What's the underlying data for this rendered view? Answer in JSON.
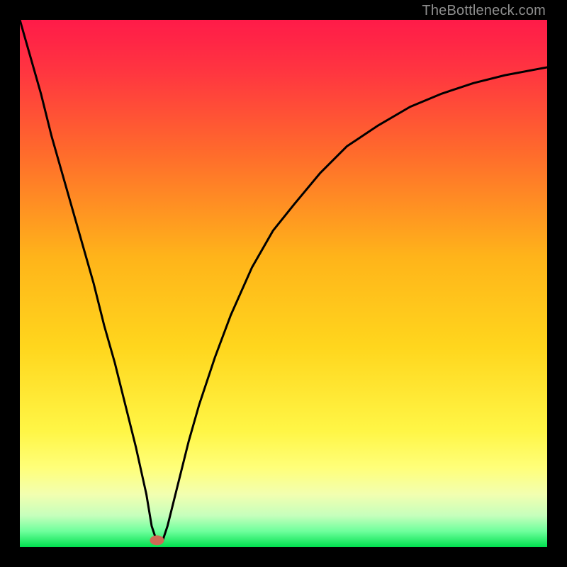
{
  "watermark": "TheBottleneck.com",
  "chart_data": {
    "type": "line",
    "title": "",
    "xlabel": "",
    "ylabel": "",
    "xlim": [
      0,
      100
    ],
    "ylim": [
      0,
      100
    ],
    "gradient_stops": [
      {
        "offset": 0.0,
        "color": "#ff1b49"
      },
      {
        "offset": 0.1,
        "color": "#ff3640"
      },
      {
        "offset": 0.25,
        "color": "#ff6a2c"
      },
      {
        "offset": 0.45,
        "color": "#ffb41a"
      },
      {
        "offset": 0.62,
        "color": "#ffd61d"
      },
      {
        "offset": 0.78,
        "color": "#fff646"
      },
      {
        "offset": 0.85,
        "color": "#ffff7a"
      },
      {
        "offset": 0.9,
        "color": "#f2ffb0"
      },
      {
        "offset": 0.94,
        "color": "#c6ffbc"
      },
      {
        "offset": 0.97,
        "color": "#6eff9c"
      },
      {
        "offset": 1.0,
        "color": "#00e04e"
      }
    ],
    "series": [
      {
        "name": "bottleneck-curve",
        "x": [
          0,
          2,
          4,
          6,
          8,
          10,
          12,
          14,
          16,
          18,
          20,
          22,
          24,
          25,
          26,
          27,
          28,
          30,
          32,
          34,
          37,
          40,
          44,
          48,
          52,
          57,
          62,
          68,
          74,
          80,
          86,
          92,
          100
        ],
        "y": [
          100,
          93,
          86,
          78,
          71,
          64,
          57,
          50,
          42,
          35,
          27,
          19,
          10,
          4,
          1,
          1,
          4,
          12,
          20,
          27,
          36,
          44,
          53,
          60,
          65,
          71,
          76,
          80,
          83.5,
          86,
          88,
          89.5,
          91
        ]
      }
    ],
    "marker": {
      "x": 26,
      "y": 1.3,
      "color": "#cf6a55",
      "rx": 10,
      "ry": 7
    }
  }
}
